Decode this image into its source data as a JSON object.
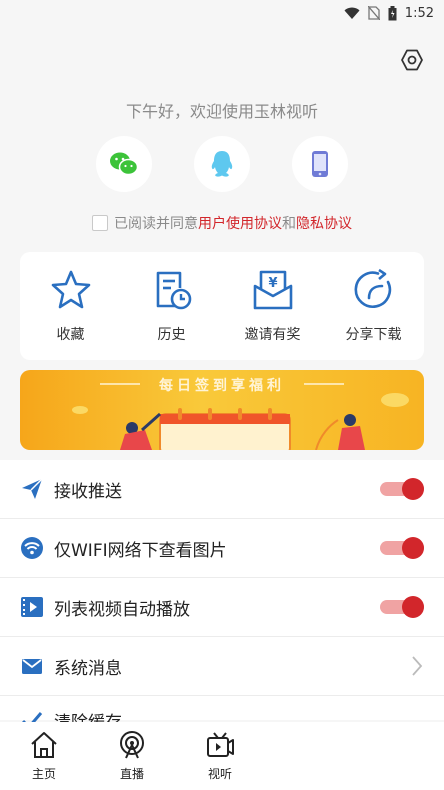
{
  "status_bar": {
    "time": "1:52",
    "icons": [
      "wifi-icon",
      "no-sim-icon",
      "battery-icon"
    ]
  },
  "header": {
    "settings_icon": "settings-hex-icon",
    "greeting": "下午好，欢迎使用玉林视听"
  },
  "login": {
    "options": [
      {
        "name": "wechat",
        "icon": "wechat-icon",
        "color": "#3cc339"
      },
      {
        "name": "qq",
        "icon": "qq-icon",
        "color": "#5ec8ef"
      },
      {
        "name": "phone",
        "icon": "phone-icon",
        "color": "#6f7bd6"
      }
    ]
  },
  "agreement": {
    "prefix": "已阅读并同意",
    "user_agreement": "用户使用协议",
    "and": "和",
    "privacy_agreement": "隐私协议",
    "checked": false
  },
  "quick_actions": [
    {
      "label": "收藏",
      "icon": "star-icon"
    },
    {
      "label": "历史",
      "icon": "history-icon"
    },
    {
      "label": "邀请有奖",
      "icon": "invite-envelope-icon"
    },
    {
      "label": "分享下载",
      "icon": "share-icon"
    }
  ],
  "banner": {
    "title": "每日签到享福利"
  },
  "settings": [
    {
      "label": "接收推送",
      "icon": "send-icon",
      "control": "toggle",
      "on": true
    },
    {
      "label": "仅WIFI网络下查看图片",
      "icon": "wifi-circle-icon",
      "control": "toggle",
      "on": true
    },
    {
      "label": "列表视频自动播放",
      "icon": "video-play-icon",
      "control": "toggle",
      "on": true
    },
    {
      "label": "系统消息",
      "icon": "mail-icon",
      "control": "chevron"
    }
  ],
  "partial_row": {
    "label": "清除缓存",
    "icon": "brush-icon"
  },
  "bottom_nav": [
    {
      "label": "主页",
      "icon": "home-icon"
    },
    {
      "label": "直播",
      "icon": "live-broadcast-icon"
    },
    {
      "label": "视听",
      "icon": "tv-play-icon"
    }
  ],
  "colors": {
    "accent_red": "#d2262b",
    "toggle_track": "#f0a3a3",
    "icon_blue": "#2a6fc0",
    "banner_yellow": "#f9c93a"
  }
}
